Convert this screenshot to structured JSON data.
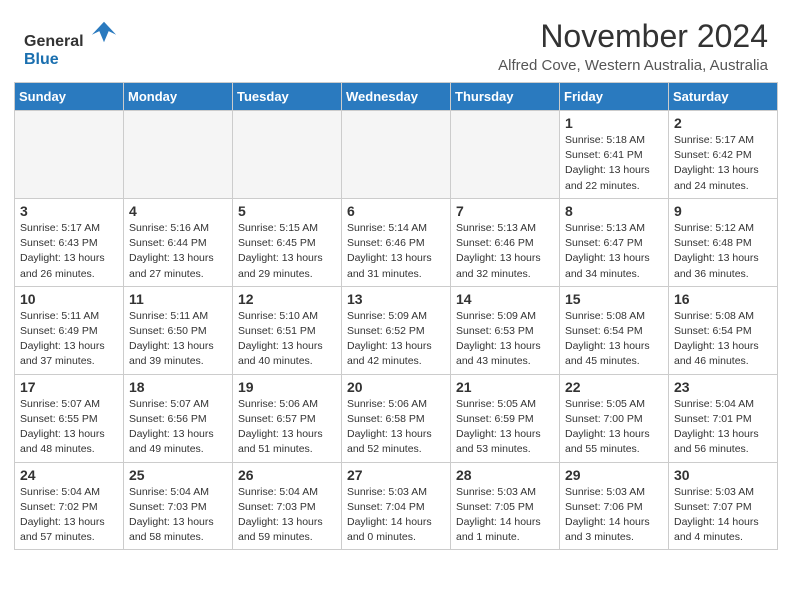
{
  "header": {
    "logo_general": "General",
    "logo_blue": "Blue",
    "month_title": "November 2024",
    "location": "Alfred Cove, Western Australia, Australia"
  },
  "weekdays": [
    "Sunday",
    "Monday",
    "Tuesday",
    "Wednesday",
    "Thursday",
    "Friday",
    "Saturday"
  ],
  "weeks": [
    [
      {
        "day": "",
        "info": ""
      },
      {
        "day": "",
        "info": ""
      },
      {
        "day": "",
        "info": ""
      },
      {
        "day": "",
        "info": ""
      },
      {
        "day": "",
        "info": ""
      },
      {
        "day": "1",
        "info": "Sunrise: 5:18 AM\nSunset: 6:41 PM\nDaylight: 13 hours\nand 22 minutes."
      },
      {
        "day": "2",
        "info": "Sunrise: 5:17 AM\nSunset: 6:42 PM\nDaylight: 13 hours\nand 24 minutes."
      }
    ],
    [
      {
        "day": "3",
        "info": "Sunrise: 5:17 AM\nSunset: 6:43 PM\nDaylight: 13 hours\nand 26 minutes."
      },
      {
        "day": "4",
        "info": "Sunrise: 5:16 AM\nSunset: 6:44 PM\nDaylight: 13 hours\nand 27 minutes."
      },
      {
        "day": "5",
        "info": "Sunrise: 5:15 AM\nSunset: 6:45 PM\nDaylight: 13 hours\nand 29 minutes."
      },
      {
        "day": "6",
        "info": "Sunrise: 5:14 AM\nSunset: 6:46 PM\nDaylight: 13 hours\nand 31 minutes."
      },
      {
        "day": "7",
        "info": "Sunrise: 5:13 AM\nSunset: 6:46 PM\nDaylight: 13 hours\nand 32 minutes."
      },
      {
        "day": "8",
        "info": "Sunrise: 5:13 AM\nSunset: 6:47 PM\nDaylight: 13 hours\nand 34 minutes."
      },
      {
        "day": "9",
        "info": "Sunrise: 5:12 AM\nSunset: 6:48 PM\nDaylight: 13 hours\nand 36 minutes."
      }
    ],
    [
      {
        "day": "10",
        "info": "Sunrise: 5:11 AM\nSunset: 6:49 PM\nDaylight: 13 hours\nand 37 minutes."
      },
      {
        "day": "11",
        "info": "Sunrise: 5:11 AM\nSunset: 6:50 PM\nDaylight: 13 hours\nand 39 minutes."
      },
      {
        "day": "12",
        "info": "Sunrise: 5:10 AM\nSunset: 6:51 PM\nDaylight: 13 hours\nand 40 minutes."
      },
      {
        "day": "13",
        "info": "Sunrise: 5:09 AM\nSunset: 6:52 PM\nDaylight: 13 hours\nand 42 minutes."
      },
      {
        "day": "14",
        "info": "Sunrise: 5:09 AM\nSunset: 6:53 PM\nDaylight: 13 hours\nand 43 minutes."
      },
      {
        "day": "15",
        "info": "Sunrise: 5:08 AM\nSunset: 6:54 PM\nDaylight: 13 hours\nand 45 minutes."
      },
      {
        "day": "16",
        "info": "Sunrise: 5:08 AM\nSunset: 6:54 PM\nDaylight: 13 hours\nand 46 minutes."
      }
    ],
    [
      {
        "day": "17",
        "info": "Sunrise: 5:07 AM\nSunset: 6:55 PM\nDaylight: 13 hours\nand 48 minutes."
      },
      {
        "day": "18",
        "info": "Sunrise: 5:07 AM\nSunset: 6:56 PM\nDaylight: 13 hours\nand 49 minutes."
      },
      {
        "day": "19",
        "info": "Sunrise: 5:06 AM\nSunset: 6:57 PM\nDaylight: 13 hours\nand 51 minutes."
      },
      {
        "day": "20",
        "info": "Sunrise: 5:06 AM\nSunset: 6:58 PM\nDaylight: 13 hours\nand 52 minutes."
      },
      {
        "day": "21",
        "info": "Sunrise: 5:05 AM\nSunset: 6:59 PM\nDaylight: 13 hours\nand 53 minutes."
      },
      {
        "day": "22",
        "info": "Sunrise: 5:05 AM\nSunset: 7:00 PM\nDaylight: 13 hours\nand 55 minutes."
      },
      {
        "day": "23",
        "info": "Sunrise: 5:04 AM\nSunset: 7:01 PM\nDaylight: 13 hours\nand 56 minutes."
      }
    ],
    [
      {
        "day": "24",
        "info": "Sunrise: 5:04 AM\nSunset: 7:02 PM\nDaylight: 13 hours\nand 57 minutes."
      },
      {
        "day": "25",
        "info": "Sunrise: 5:04 AM\nSunset: 7:03 PM\nDaylight: 13 hours\nand 58 minutes."
      },
      {
        "day": "26",
        "info": "Sunrise: 5:04 AM\nSunset: 7:03 PM\nDaylight: 13 hours\nand 59 minutes."
      },
      {
        "day": "27",
        "info": "Sunrise: 5:03 AM\nSunset: 7:04 PM\nDaylight: 14 hours\nand 0 minutes."
      },
      {
        "day": "28",
        "info": "Sunrise: 5:03 AM\nSunset: 7:05 PM\nDaylight: 14 hours\nand 1 minute."
      },
      {
        "day": "29",
        "info": "Sunrise: 5:03 AM\nSunset: 7:06 PM\nDaylight: 14 hours\nand 3 minutes."
      },
      {
        "day": "30",
        "info": "Sunrise: 5:03 AM\nSunset: 7:07 PM\nDaylight: 14 hours\nand 4 minutes."
      }
    ]
  ]
}
